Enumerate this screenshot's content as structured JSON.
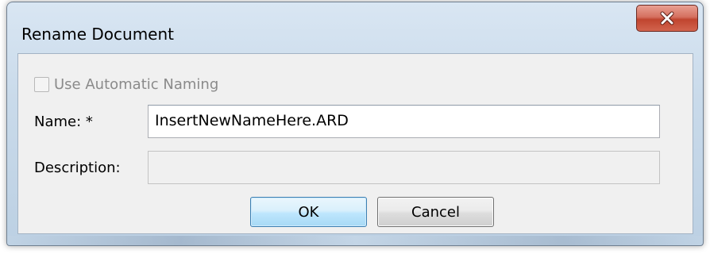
{
  "window": {
    "title": "Rename Document",
    "close_icon": "close-x-icon"
  },
  "form": {
    "auto_naming": {
      "label": "Use Automatic Naming",
      "checked": false,
      "enabled": false
    },
    "name": {
      "label": "Name:  *",
      "value": "InsertNewNameHere.ARD"
    },
    "description": {
      "label": "Description:",
      "value": "",
      "enabled": false
    }
  },
  "buttons": {
    "ok_label": "OK",
    "cancel_label": "Cancel"
  },
  "colors": {
    "close_button": "#c7503a",
    "ok_button_border": "#3c7fb1",
    "client_background": "#f0f0f0"
  }
}
